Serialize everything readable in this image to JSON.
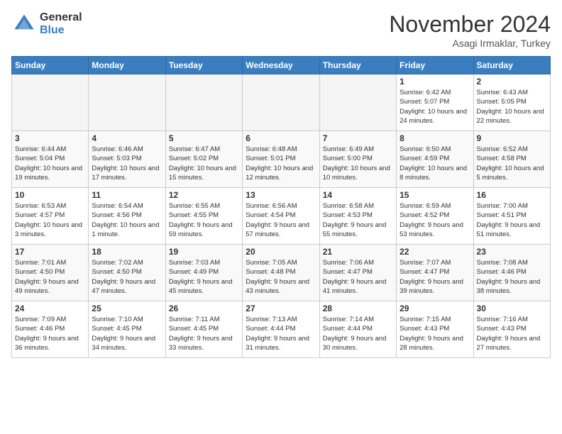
{
  "header": {
    "logo_general": "General",
    "logo_blue": "Blue",
    "month_title": "November 2024",
    "subtitle": "Asagi Irmaklar, Turkey"
  },
  "days_of_week": [
    "Sunday",
    "Monday",
    "Tuesday",
    "Wednesday",
    "Thursday",
    "Friday",
    "Saturday"
  ],
  "weeks": [
    [
      {
        "day": "",
        "info": ""
      },
      {
        "day": "",
        "info": ""
      },
      {
        "day": "",
        "info": ""
      },
      {
        "day": "",
        "info": ""
      },
      {
        "day": "",
        "info": ""
      },
      {
        "day": "1",
        "info": "Sunrise: 6:42 AM\nSunset: 5:07 PM\nDaylight: 10 hours and 24 minutes."
      },
      {
        "day": "2",
        "info": "Sunrise: 6:43 AM\nSunset: 5:05 PM\nDaylight: 10 hours and 22 minutes."
      }
    ],
    [
      {
        "day": "3",
        "info": "Sunrise: 6:44 AM\nSunset: 5:04 PM\nDaylight: 10 hours and 19 minutes."
      },
      {
        "day": "4",
        "info": "Sunrise: 6:46 AM\nSunset: 5:03 PM\nDaylight: 10 hours and 17 minutes."
      },
      {
        "day": "5",
        "info": "Sunrise: 6:47 AM\nSunset: 5:02 PM\nDaylight: 10 hours and 15 minutes."
      },
      {
        "day": "6",
        "info": "Sunrise: 6:48 AM\nSunset: 5:01 PM\nDaylight: 10 hours and 12 minutes."
      },
      {
        "day": "7",
        "info": "Sunrise: 6:49 AM\nSunset: 5:00 PM\nDaylight: 10 hours and 10 minutes."
      },
      {
        "day": "8",
        "info": "Sunrise: 6:50 AM\nSunset: 4:59 PM\nDaylight: 10 hours and 8 minutes."
      },
      {
        "day": "9",
        "info": "Sunrise: 6:52 AM\nSunset: 4:58 PM\nDaylight: 10 hours and 5 minutes."
      }
    ],
    [
      {
        "day": "10",
        "info": "Sunrise: 6:53 AM\nSunset: 4:57 PM\nDaylight: 10 hours and 3 minutes."
      },
      {
        "day": "11",
        "info": "Sunrise: 6:54 AM\nSunset: 4:56 PM\nDaylight: 10 hours and 1 minute."
      },
      {
        "day": "12",
        "info": "Sunrise: 6:55 AM\nSunset: 4:55 PM\nDaylight: 9 hours and 59 minutes."
      },
      {
        "day": "13",
        "info": "Sunrise: 6:56 AM\nSunset: 4:54 PM\nDaylight: 9 hours and 57 minutes."
      },
      {
        "day": "14",
        "info": "Sunrise: 6:58 AM\nSunset: 4:53 PM\nDaylight: 9 hours and 55 minutes."
      },
      {
        "day": "15",
        "info": "Sunrise: 6:59 AM\nSunset: 4:52 PM\nDaylight: 9 hours and 53 minutes."
      },
      {
        "day": "16",
        "info": "Sunrise: 7:00 AM\nSunset: 4:51 PM\nDaylight: 9 hours and 51 minutes."
      }
    ],
    [
      {
        "day": "17",
        "info": "Sunrise: 7:01 AM\nSunset: 4:50 PM\nDaylight: 9 hours and 49 minutes."
      },
      {
        "day": "18",
        "info": "Sunrise: 7:02 AM\nSunset: 4:50 PM\nDaylight: 9 hours and 47 minutes."
      },
      {
        "day": "19",
        "info": "Sunrise: 7:03 AM\nSunset: 4:49 PM\nDaylight: 9 hours and 45 minutes."
      },
      {
        "day": "20",
        "info": "Sunrise: 7:05 AM\nSunset: 4:48 PM\nDaylight: 9 hours and 43 minutes."
      },
      {
        "day": "21",
        "info": "Sunrise: 7:06 AM\nSunset: 4:47 PM\nDaylight: 9 hours and 41 minutes."
      },
      {
        "day": "22",
        "info": "Sunrise: 7:07 AM\nSunset: 4:47 PM\nDaylight: 9 hours and 39 minutes."
      },
      {
        "day": "23",
        "info": "Sunrise: 7:08 AM\nSunset: 4:46 PM\nDaylight: 9 hours and 38 minutes."
      }
    ],
    [
      {
        "day": "24",
        "info": "Sunrise: 7:09 AM\nSunset: 4:46 PM\nDaylight: 9 hours and 36 minutes."
      },
      {
        "day": "25",
        "info": "Sunrise: 7:10 AM\nSunset: 4:45 PM\nDaylight: 9 hours and 34 minutes."
      },
      {
        "day": "26",
        "info": "Sunrise: 7:11 AM\nSunset: 4:45 PM\nDaylight: 9 hours and 33 minutes."
      },
      {
        "day": "27",
        "info": "Sunrise: 7:13 AM\nSunset: 4:44 PM\nDaylight: 9 hours and 31 minutes."
      },
      {
        "day": "28",
        "info": "Sunrise: 7:14 AM\nSunset: 4:44 PM\nDaylight: 9 hours and 30 minutes."
      },
      {
        "day": "29",
        "info": "Sunrise: 7:15 AM\nSunset: 4:43 PM\nDaylight: 9 hours and 28 minutes."
      },
      {
        "day": "30",
        "info": "Sunrise: 7:16 AM\nSunset: 4:43 PM\nDaylight: 9 hours and 27 minutes."
      }
    ]
  ]
}
